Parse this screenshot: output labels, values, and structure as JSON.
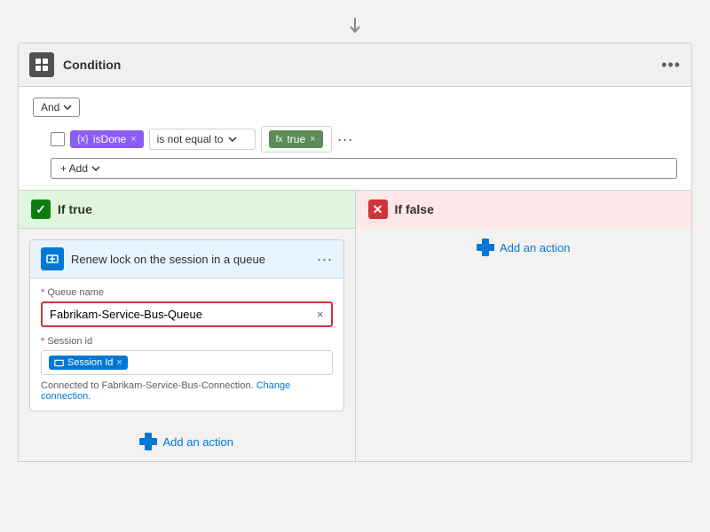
{
  "arrow": "↓",
  "condition": {
    "title": "Condition",
    "more_icon": "•••",
    "and_label": "And",
    "field_name": "isDone",
    "operator": "is not equal to",
    "value": "true",
    "add_label": "+ Add"
  },
  "branches": {
    "true": {
      "header": "If true",
      "action": {
        "title": "Renew lock on the session in a queue",
        "queue_label": "Queue name",
        "queue_value": "Fabrikam-Service-Bus-Queue",
        "session_label": "Session id",
        "session_tag": "Session Id",
        "connection_text": "Connected to Fabrikam-Service-Bus-Connection.",
        "change_connection": "Change connection."
      },
      "add_action_label": "Add an action"
    },
    "false": {
      "header": "If false",
      "add_action_label": "Add an action"
    }
  }
}
